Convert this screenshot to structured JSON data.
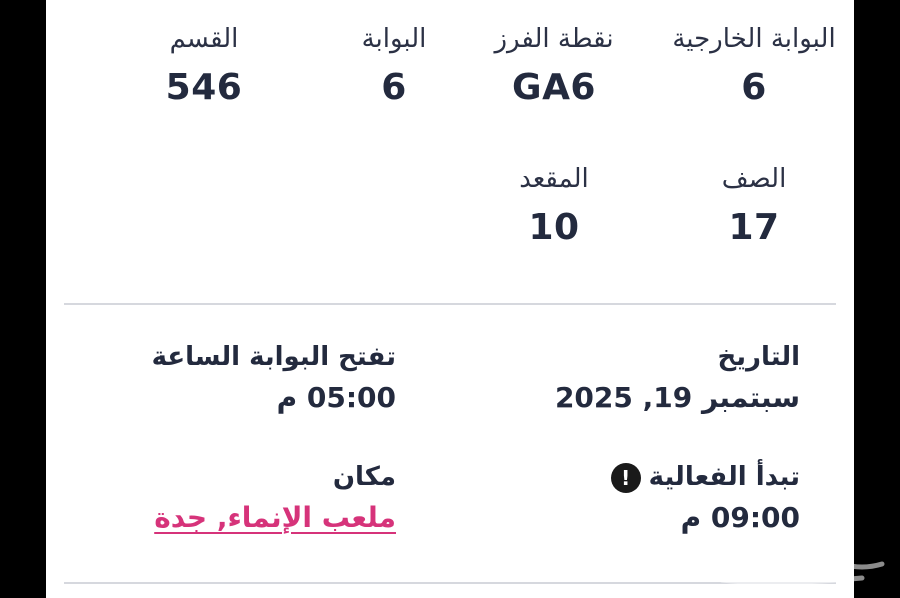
{
  "seat_info": {
    "external_gate": {
      "label": "البوابة الخارجية",
      "value": "6"
    },
    "sorting_point": {
      "label": "نقطة الفرز",
      "value": "GA6"
    },
    "gate": {
      "label": "البوابة",
      "value": "6"
    },
    "section": {
      "label": "القسم",
      "value": "546"
    },
    "row": {
      "label": "الصف",
      "value": "17"
    },
    "seat": {
      "label": "المقعد",
      "value": "10"
    }
  },
  "event_details": {
    "date": {
      "label": "التاريخ",
      "value": "سبتمبر 19, 2025"
    },
    "gates_open": {
      "label": "تفتح البوابة الساعة",
      "value": "05:00 م"
    },
    "event_start": {
      "label": "تبدأ الفعالية",
      "value": "09:00 م",
      "icon": "alert-icon"
    },
    "venue": {
      "label": "مكان",
      "value": "ملعب الإنماء, جدة"
    }
  },
  "colors": {
    "link": "#d6337a",
    "text": "#232a3e",
    "divider": "#d6d8de"
  }
}
